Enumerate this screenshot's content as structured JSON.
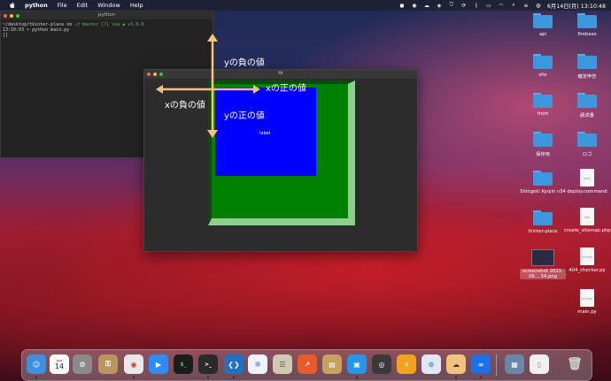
{
  "menubar": {
    "app": "python",
    "items": [
      "File",
      "Edit",
      "Window",
      "Help"
    ],
    "datetime": "6月14日(月)  13:10:48"
  },
  "terminal": {
    "title": "python",
    "line1_path": "~/desktop/tkinter-place on",
    "line1_branch": "master [?] via",
    "line1_version": "v3.8.0",
    "line2": "13:10:03 > python main.py",
    "line3": "[]"
  },
  "tk_window": {
    "title": "tk",
    "label_text": "label"
  },
  "annotations": {
    "y_negative": "yの負の値",
    "x_positive": "xの正の値",
    "x_negative": "xの負の値",
    "y_positive": "yの正の値"
  },
  "desktop": {
    "icons": [
      {
        "label": "api",
        "kind": "folder"
      },
      {
        "label": "firebase",
        "kind": "folder"
      },
      {
        "label": "site",
        "kind": "folder"
      },
      {
        "label": "確定申告",
        "kind": "folder"
      },
      {
        "label": "front",
        "kind": "folder"
      },
      {
        "label": "請求書",
        "kind": "folder"
      },
      {
        "label": "保存用",
        "kind": "folder"
      },
      {
        "label": "ロゴ",
        "kind": "folder"
      },
      {
        "label": "Shingeki Kyojin v34",
        "kind": "folder"
      },
      {
        "label": "deploy.command",
        "kind": "doc",
        "tag": "EXEC"
      },
      {
        "label": "tkinter-place",
        "kind": "folder"
      },
      {
        "label": "create_sitemap.php",
        "kind": "doc",
        "tag": "PHP"
      },
      {
        "label": "screenshot 2021-06....34.png",
        "kind": "image"
      },
      {
        "label": "404_checker.py",
        "kind": "doc",
        "tag": "PYTHON"
      },
      {
        "label": "main.py",
        "kind": "doc",
        "tag": "PYTHON"
      }
    ]
  },
  "dock": {
    "calendar_month": "JUN",
    "calendar_day": "14",
    "apps": [
      "finder",
      "calendar",
      "system-preferences",
      "keychain",
      "chrome",
      "zoom",
      "terminal-green",
      "terminal",
      "vscode",
      "safari",
      "sequel",
      "stocks",
      "archive",
      "docker",
      "quicktime",
      "sourcetree",
      "proxyman",
      "notes-app",
      "infinity",
      "preview",
      "document",
      "trash"
    ],
    "colors": {
      "finder": "#3d8fe0",
      "calendar": "#ffffff",
      "system-preferences": "#8a8a8a",
      "keychain": "#b8955a",
      "chrome": "#e8e8e8",
      "zoom": "#2d8cff",
      "terminal-green": "#1c1c1c",
      "terminal": "#2a2a2a",
      "vscode": "#1d72c7",
      "safari": "#f0f4ff",
      "sequel": "#d0c8b0",
      "stocks": "#e85a2a",
      "archive": "#c8a060",
      "docker": "#2496ed",
      "quicktime": "#3a3a3a",
      "sourcetree": "#f3a21a",
      "proxyman": "#dfe8f5",
      "notes-app": "#f2c27b",
      "infinity": "#1e6fe8",
      "preview": "#6a86a8",
      "document": "#f0f0f0",
      "trash": "#9a9a9a"
    }
  }
}
